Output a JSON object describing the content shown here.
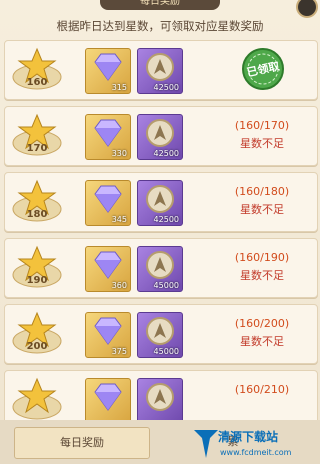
{
  "header": {
    "title": "每日奖励"
  },
  "hint": "根据昨日达到星数，可领取对应星数奖励",
  "rows": [
    {
      "stars": "160",
      "diamond_qty": "315",
      "coin_qty": "42500",
      "status": "claimed",
      "claimed_label": "已领取"
    },
    {
      "stars": "170",
      "diamond_qty": "330",
      "coin_qty": "42500",
      "progress": "(160/170)",
      "status_text": "星数不足"
    },
    {
      "stars": "180",
      "diamond_qty": "345",
      "coin_qty": "42500",
      "progress": "(160/180)",
      "status_text": "星数不足"
    },
    {
      "stars": "190",
      "diamond_qty": "360",
      "coin_qty": "45000",
      "progress": "(160/190)",
      "status_text": "星数不足"
    },
    {
      "stars": "200",
      "diamond_qty": "375",
      "coin_qty": "45000",
      "progress": "(160/200)",
      "status_text": "星数不足"
    },
    {
      "stars": "",
      "diamond_qty": "",
      "coin_qty": "",
      "progress": "(160/210)",
      "status_text": ""
    }
  ],
  "tabs": {
    "daily": "每日奖励",
    "cumulative": "累"
  },
  "watermark": {
    "brand": "清源下载站",
    "url": "www.fcdmeit.com"
  },
  "colors": {
    "accent_red": "#c23a2a",
    "gold": "#d8a540",
    "purple": "#6f49ad",
    "claimed_green": "#3f9a3a"
  }
}
